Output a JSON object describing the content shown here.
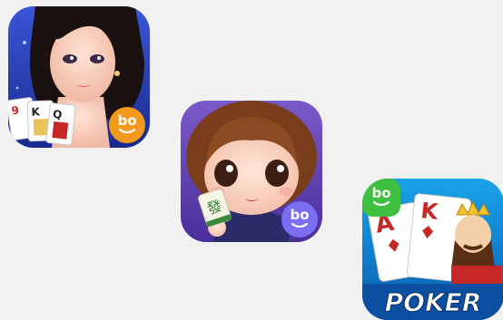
{
  "icons": [
    {
      "id": "app-icon-1",
      "badge_text": "bo",
      "card_ranks": [
        "9",
        "K",
        "Q"
      ],
      "colors": {
        "bg_top": "#3a56d6",
        "bg_bottom": "#1a2a8e",
        "badge": "#f39a1e"
      }
    },
    {
      "id": "app-icon-2",
      "badge_text": "bo",
      "tile_glyph": "發",
      "colors": {
        "bg_top": "#7a5ac8",
        "bg_bottom": "#4a2e9a",
        "badge": "#7b6ef0"
      }
    },
    {
      "id": "app-icon-3",
      "badge_text": "bo",
      "card_ranks": [
        "A",
        "K"
      ],
      "label": "POKER",
      "colors": {
        "bg_top": "#1aa3e8",
        "bg_bottom": "#0a5cb0",
        "badge": "#3fbf3f"
      }
    }
  ]
}
